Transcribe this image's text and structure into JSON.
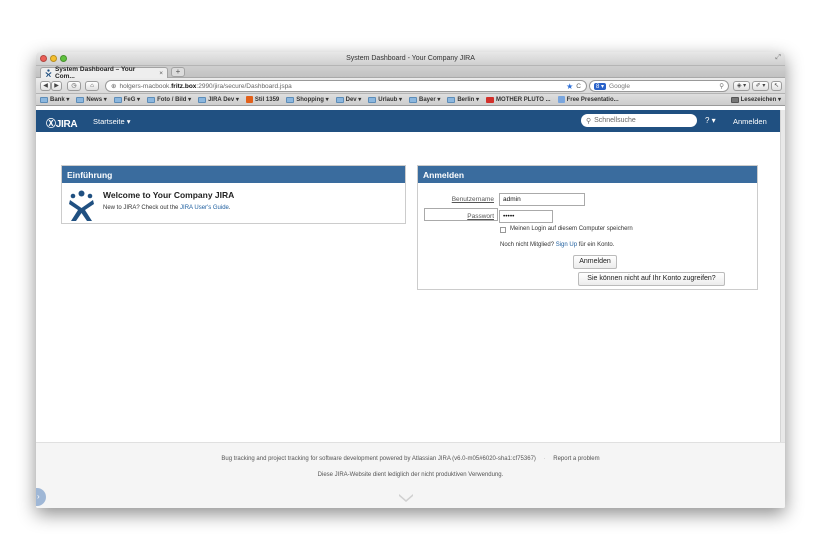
{
  "window": {
    "title": "System Dashboard - Your Company JIRA"
  },
  "tab": {
    "title": "System Dashboard – Your Com...",
    "close": "×",
    "new": "+"
  },
  "nav": {
    "back": "◀",
    "forward": "▶",
    "history": "◷",
    "home": "⌂",
    "url_prefix": "holgers-macbook.",
    "url_host": "fritz.box",
    "url_rest": ":2990/jira/secure/Dashboard.jspa",
    "search_engine": "Google",
    "star": "★",
    "refresh": "C",
    "ext1": "◈ ▾",
    "ext2": "✐ ▾",
    "ext3": "↖"
  },
  "bookmarks": {
    "items": [
      {
        "label": "Bank ▾",
        "kind": "folder"
      },
      {
        "label": "News ▾",
        "kind": "folder"
      },
      {
        "label": "FeG ▾",
        "kind": "folder"
      },
      {
        "label": "Foto / Bild ▾",
        "kind": "folder"
      },
      {
        "label": "JIRA Dev ▾",
        "kind": "folder"
      },
      {
        "label": "Stil 1359",
        "kind": "site"
      },
      {
        "label": "Shopping ▾",
        "kind": "folder"
      },
      {
        "label": "Dev ▾",
        "kind": "folder"
      },
      {
        "label": "Urlaub ▾",
        "kind": "folder"
      },
      {
        "label": "Bayer ▾",
        "kind": "folder"
      },
      {
        "label": "Berlin ▾",
        "kind": "folder"
      },
      {
        "label": "MOTHER PLUTO ...",
        "kind": "video"
      },
      {
        "label": "Free Presentatio...",
        "kind": "feed"
      }
    ],
    "reading_list": "Lesezeichen ▾"
  },
  "jira": {
    "logo": "JIRA",
    "menu": "Startseite ▾",
    "search_placeholder": "Schnellsuche",
    "help": "? ▾",
    "login": "Anmelden"
  },
  "intro": {
    "heading": "Einführung",
    "title": "Welcome to Your Company JIRA",
    "text_before": "New to JIRA? Check out the ",
    "link": "JIRA User's Guide",
    "text_after": "."
  },
  "login_panel": {
    "heading": "Anmelden",
    "username_label": "Benutzername",
    "username_value": "admin",
    "password_label": "Passwort",
    "password_value": "•••••",
    "remember": "Meinen Login auf diesem Computer speichern",
    "signup_before": "Noch nicht Mitglied? ",
    "signup_link": "Sign Up",
    "signup_after": " für ein Konto.",
    "submit": "Anmelden",
    "forgot": "Sie können nicht auf Ihr Konto zugreifen?"
  },
  "footer": {
    "line1": "Bug tracking and project tracking for software development powered by Atlassian JIRA (v6.0-m05#6020-sha1:cf75367)",
    "sep": "·",
    "report": "Report a problem",
    "line2": "Diese JIRA-Website dient lediglich der nicht produktiven Verwendung."
  },
  "colors": {
    "jira_header": "#205081",
    "panel_header": "#3a6c9e",
    "link": "#2060a0"
  }
}
